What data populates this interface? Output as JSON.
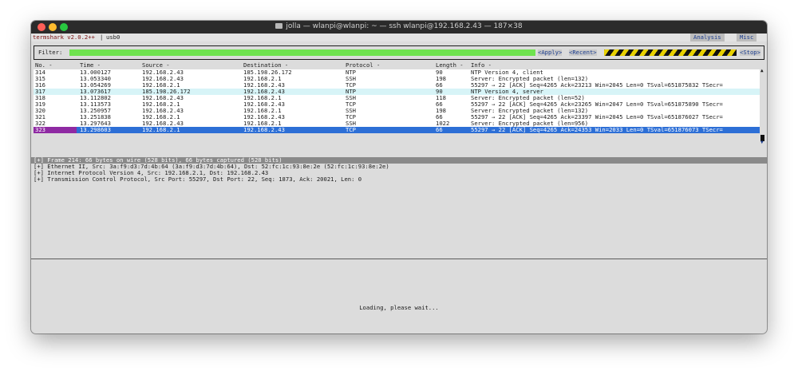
{
  "window": {
    "title": "jolla — wlanpi@wlanpi: ~ — ssh wlanpi@192.168.2.43 — 187×38"
  },
  "app": {
    "name": "termshark v2.0.2++",
    "separator": "|",
    "interface": "usb0",
    "menu": [
      "Analysis",
      "Misc"
    ]
  },
  "filter": {
    "label": "Filter:",
    "value": "",
    "apply": "<Apply>",
    "recent": "<Recent>",
    "stop": "<Stop>"
  },
  "colors": {
    "filter_valid": "#6fe34f",
    "selected_row": "#2d6fd6",
    "selected_no_cell": "#8f2aa3",
    "row_cyan": "#d7f4f7"
  },
  "packets": {
    "columns": [
      "No. -",
      "Time -",
      "Source -",
      "Destination -",
      "Protocol -",
      "Length -",
      "Info -"
    ],
    "rows": [
      {
        "no": "314",
        "time": "13.000127",
        "src": "192.168.2.43",
        "dst": "185.198.26.172",
        "proto": "NTP",
        "len": "90",
        "info": "NTP Version 4, client"
      },
      {
        "no": "315",
        "time": "13.053340",
        "src": "192.168.2.43",
        "dst": "192.168.2.1",
        "proto": "SSH",
        "len": "198",
        "info": "Server: Encrypted packet (len=132)"
      },
      {
        "no": "316",
        "time": "13.054269",
        "src": "192.168.2.1",
        "dst": "192.168.2.43",
        "proto": "TCP",
        "len": "66",
        "info": "55297 → 22 [ACK] Seq=4265 Ack=23213 Win=2045 Len=0 TSval=651875832 TSecr="
      },
      {
        "no": "317",
        "time": "13.073617",
        "src": "185.198.26.172",
        "dst": "192.168.2.43",
        "proto": "NTP",
        "len": "90",
        "info": "NTP Version 4, server"
      },
      {
        "no": "318",
        "time": "13.112802",
        "src": "192.168.2.43",
        "dst": "192.168.2.1",
        "proto": "SSH",
        "len": "118",
        "info": "Server: Encrypted packet (len=52)"
      },
      {
        "no": "319",
        "time": "13.113573",
        "src": "192.168.2.1",
        "dst": "192.168.2.43",
        "proto": "TCP",
        "len": "66",
        "info": "55297 → 22 [ACK] Seq=4265 Ack=23265 Win=2047 Len=0 TSval=651875890 TSecr="
      },
      {
        "no": "320",
        "time": "13.250957",
        "src": "192.168.2.43",
        "dst": "192.168.2.1",
        "proto": "SSH",
        "len": "198",
        "info": "Server: Encrypted packet (len=132)"
      },
      {
        "no": "321",
        "time": "13.251838",
        "src": "192.168.2.1",
        "dst": "192.168.2.43",
        "proto": "TCP",
        "len": "66",
        "info": "55297 → 22 [ACK] Seq=4265 Ack=23397 Win=2045 Len=0 TSval=651876027 TSecr="
      },
      {
        "no": "322",
        "time": "13.297643",
        "src": "192.168.2.43",
        "dst": "192.168.2.1",
        "proto": "SSH",
        "len": "1022",
        "info": "Server: Encrypted packet (len=956)"
      },
      {
        "no": "323",
        "time": "13.298603",
        "src": "192.168.2.1",
        "dst": "192.168.2.43",
        "proto": "TCP",
        "len": "66",
        "info": "55297 → 22 [ACK] Seq=4265 Ack=24353 Win=2033 Len=0 TSval=651876073 TSecr="
      }
    ],
    "selected_no": "323"
  },
  "details": [
    "[+] Frame 214: 66 bytes on wire (528 bits), 66 bytes captured (528 bits)",
    "[+] Ethernet II, Src: 3a:f9:d3:7d:4b:64 (3a:f9:d3:7d:4b:64), Dst: 52:fc:1c:93:8e:2e (52:fc:1c:93:8e:2e)",
    "[+] Internet Protocol Version 4, Src: 192.168.2.1, Dst: 192.168.2.43",
    "[+] Transmission Control Protocol, Src Port: 55297, Dst Port: 22, Seq: 1873, Ack: 20021, Len: 0"
  ],
  "bytes_pane": {
    "status": "Loading, please wait..."
  }
}
